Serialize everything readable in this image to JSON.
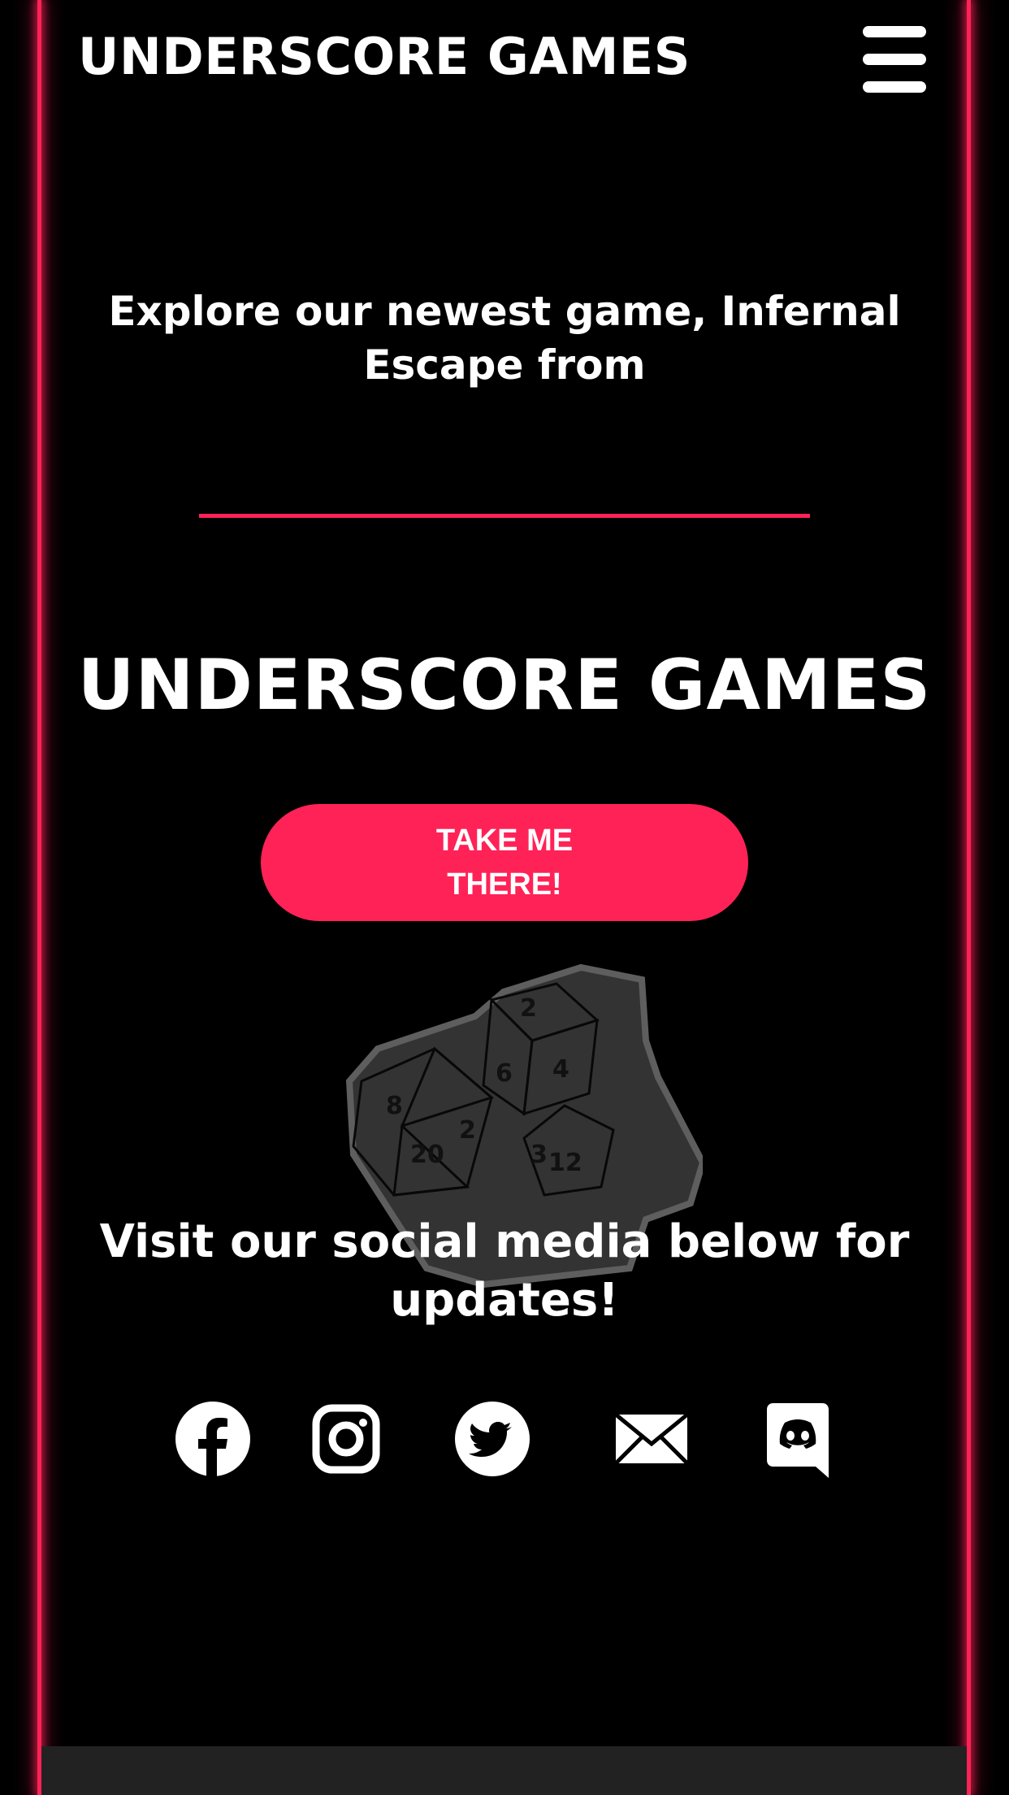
{
  "header": {
    "title": "UNDERSCORE GAMES",
    "menu_icon": "hamburger-menu-icon"
  },
  "hero": {
    "intro": "Explore our newest game, Infernal Escape from",
    "title": "UNDERSCORE GAMES",
    "cta_label": "TAKE ME THERE!",
    "logo_icon": "dice-logo"
  },
  "social": {
    "heading": "Visit our social media below for updates!",
    "links": [
      {
        "icon": "facebook-icon"
      },
      {
        "icon": "instagram-icon"
      },
      {
        "icon": "twitter-icon"
      },
      {
        "icon": "email-icon"
      },
      {
        "icon": "discord-icon"
      }
    ]
  },
  "colors": {
    "accent": "#ff2257",
    "background": "#000000",
    "text": "#ffffff",
    "footer": "#222222"
  }
}
